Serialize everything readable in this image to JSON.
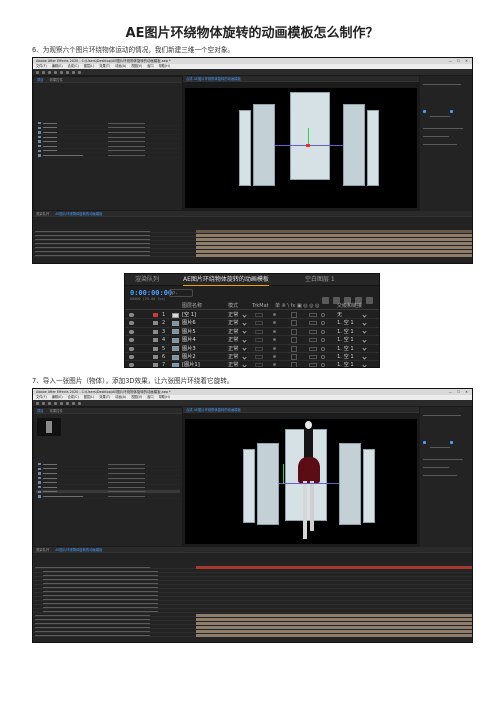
{
  "page": {
    "title": "AE图片环绕物体旋转的动画模板怎么制作？",
    "step6": "6、为观察六个图片环绕物体运动的情况，我们新建三维一个空对象。",
    "step7": "7、导入一张图片（物体），添加3D效果，让六张图片环绕着它旋转。"
  },
  "ae_window": {
    "titlebar": "Adobe After Effects 2020 - C:\\Users\\Desktop\\AE图片环绕物体旋转的动画模板.aep *",
    "window_controls": "— ☐ ✕",
    "menu": [
      "文件(F)",
      "编辑(E)",
      "合成(C)",
      "图层(L)",
      "效果(T)",
      "动画(A)",
      "视图(V)",
      "窗口",
      "帮助(H)"
    ]
  },
  "zoom_panel": {
    "tabs": [
      "渲染队列",
      "AE图片环绕物体旋转的动画模板",
      "空白图层 1"
    ],
    "timecode": "0:00:00:00",
    "timecode_sub": "00000 (25.00 fps)",
    "search_placeholder": "ρ.",
    "headers": {
      "layer_name": "图层名称",
      "mode": "模式",
      "trkmat": "TrkMat",
      "switches": "单 ※ \\ fx ▣ ◎ ◎ ◎",
      "parent": "父级和链接"
    },
    "layers": [
      {
        "num": "1",
        "name": "[空 1]",
        "mode": "正常",
        "parent": "无",
        "color": "#c93a3a",
        "thumb_color": "#d9d9d9"
      },
      {
        "num": "2",
        "name": "图片6",
        "mode": "正常",
        "parent": "1. 空 1",
        "color": "#8a8a8a",
        "thumb_color": "#6f96b4"
      },
      {
        "num": "3",
        "name": "图片5",
        "mode": "正常",
        "parent": "1. 空 1",
        "color": "#8a8a8a",
        "thumb_color": "#6f96b4"
      },
      {
        "num": "4",
        "name": "图片4",
        "mode": "正常",
        "parent": "1. 空 1",
        "color": "#8a8a8a",
        "thumb_color": "#6f96b4"
      },
      {
        "num": "5",
        "name": "图片3",
        "mode": "正常",
        "parent": "1. 空 1",
        "color": "#8a8a8a",
        "thumb_color": "#6f96b4"
      },
      {
        "num": "6",
        "name": "图片2",
        "mode": "正常",
        "parent": "1. 空 1",
        "color": "#8a8a8a",
        "thumb_color": "#6f96b4"
      },
      {
        "num": "7",
        "name": "[图片1]",
        "mode": "正常",
        "parent": "1. 空 1",
        "color": "#8a8a8a",
        "thumb_color": "#6f96b4"
      }
    ]
  },
  "colors": {
    "accent": "#4a9cff",
    "stage": "#000000",
    "pane": "#d6e1e6",
    "track": "#8f7d6b",
    "selected_track": "#a5392f",
    "tab_highlight": "#e8a300"
  }
}
